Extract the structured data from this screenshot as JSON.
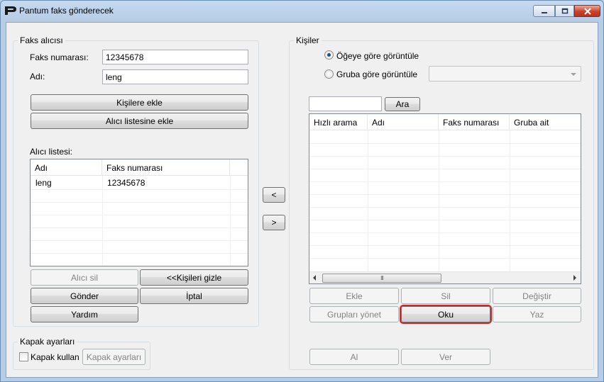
{
  "window": {
    "title": "Pantum faks gönderecek"
  },
  "recipient": {
    "group_title": "Faks alıcısı",
    "fax_number_label": "Faks numarası:",
    "fax_number_value": "12345678",
    "name_label": "Adı:",
    "name_value": "leng",
    "add_to_contacts_label": "Kişilere ekle",
    "add_to_recipients_label": "Alıcı listesine ekle",
    "list_label": "Alıcı listesi:",
    "columns": [
      "Adı",
      "Faks numarası"
    ],
    "rows": [
      {
        "name": "leng",
        "fax": "12345678"
      }
    ],
    "delete_recipient_label": "Alıcı sil",
    "hide_contacts_label": "<<Kişileri gizle",
    "send_label": "Gönder",
    "cancel_label": "İptal",
    "help_label": "Yardım"
  },
  "cover": {
    "group_title": "Kapak ayarları",
    "use_cover_label": "Kapak kullan",
    "cover_settings_label": "Kapak ayarları"
  },
  "transfer": {
    "left_label": "<",
    "right_label": ">"
  },
  "contacts": {
    "group_title": "Kişiler",
    "view_by_item_label": "Öğeye göre görüntüle",
    "view_by_group_label": "Gruba göre görüntüle",
    "search_value": "",
    "search_label": "Ara",
    "columns": [
      "Hızlı arama",
      "Adı",
      "Faks numarası",
      "Gruba ait"
    ],
    "scroll_grip": "III",
    "add_label": "Ekle",
    "delete_label": "Sil",
    "edit_label": "Değiştir",
    "manage_groups_label": "Grupları yönet",
    "read_label": "Oku",
    "write_label": "Yaz",
    "receive_label": "Al",
    "give_label": "Ver"
  }
}
